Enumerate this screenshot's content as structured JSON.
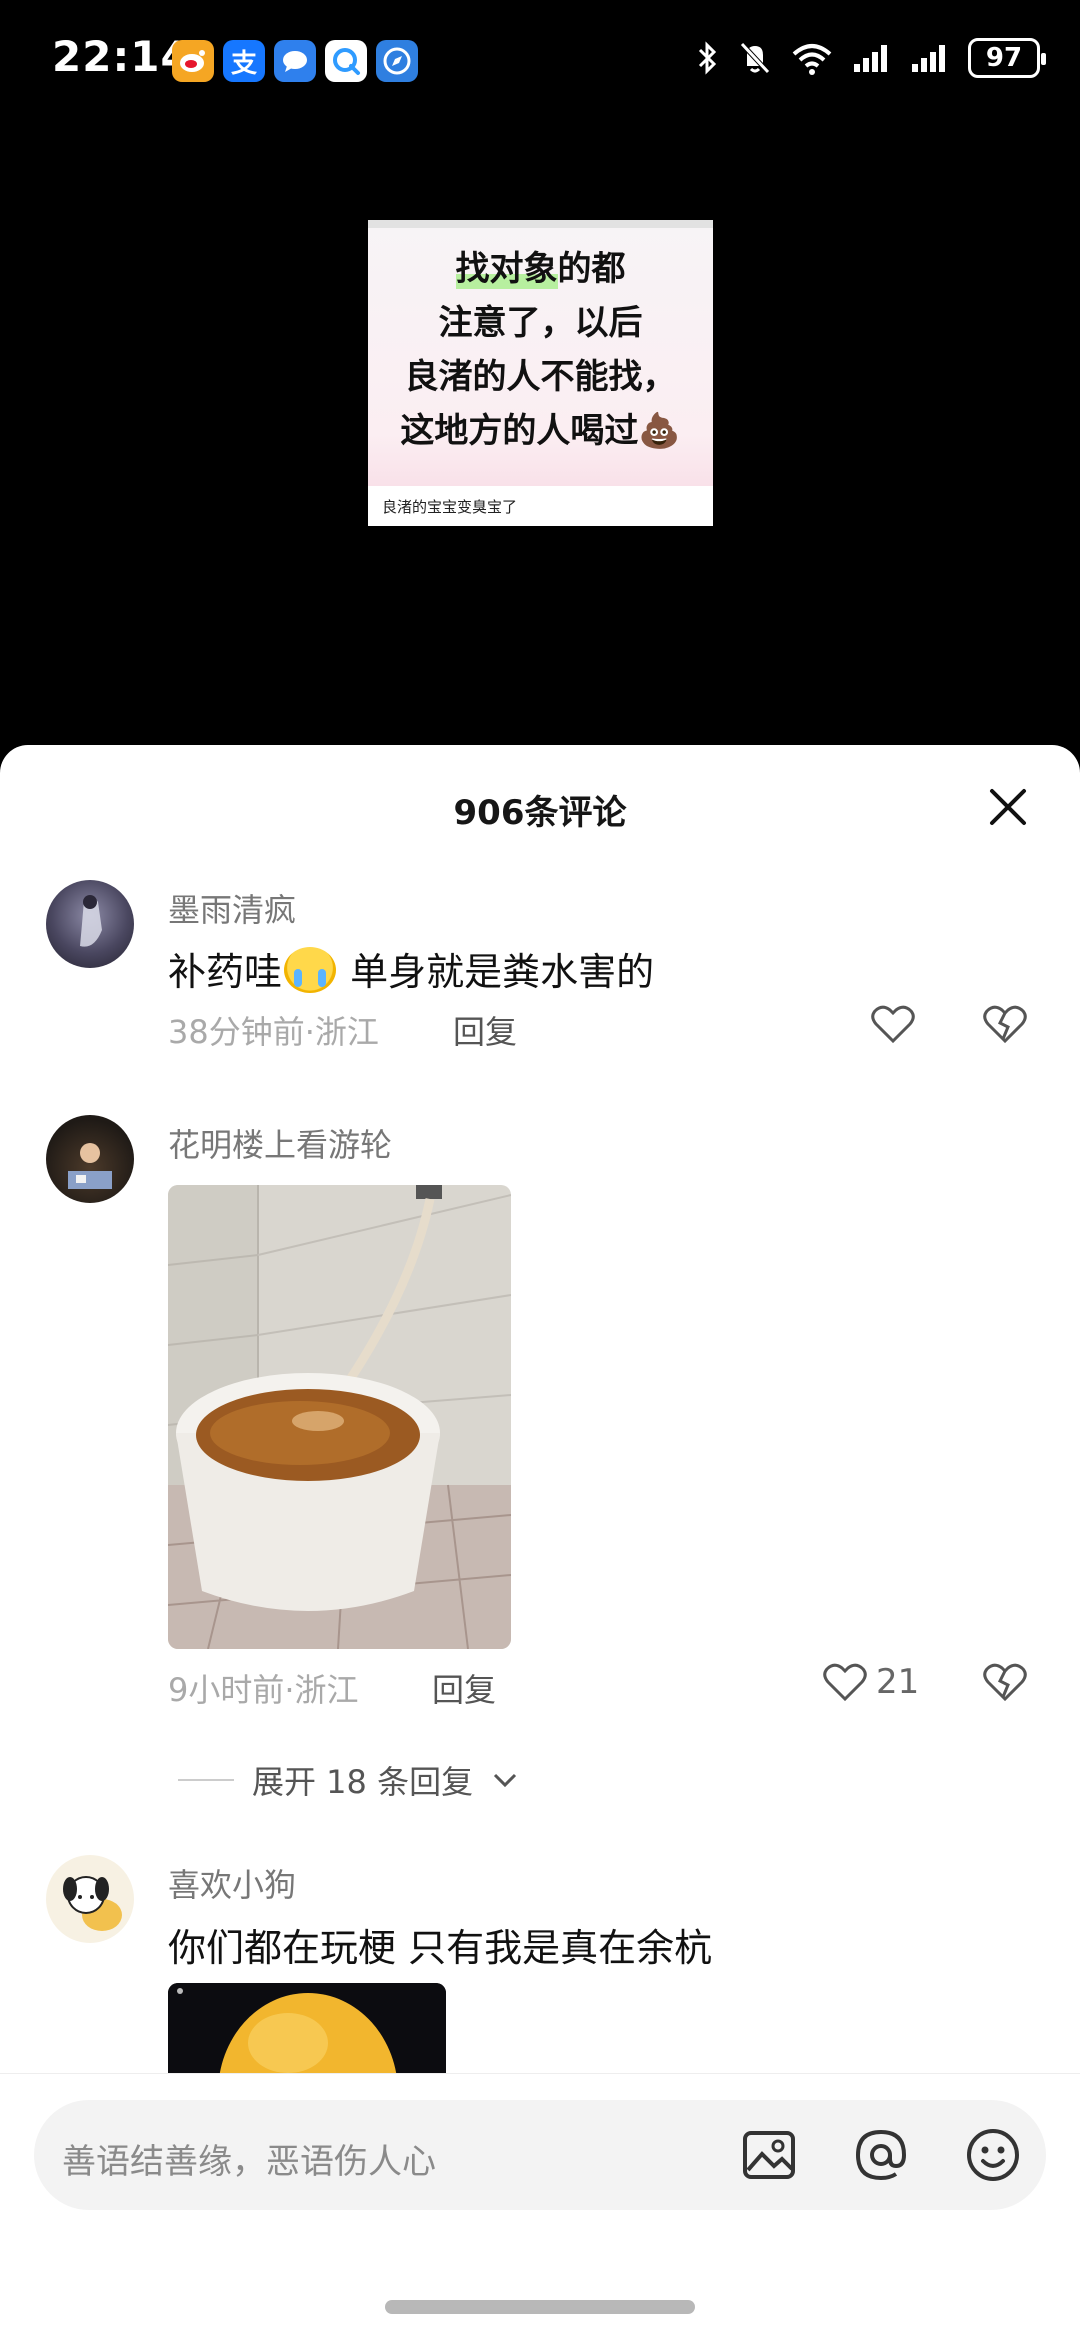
{
  "status_bar": {
    "time": "22:14",
    "battery": "97",
    "app_icons": [
      {
        "name": "weibo-icon",
        "color": "#f5a623",
        "glyph": "◉"
      },
      {
        "name": "alipay-icon",
        "color": "#1677ff",
        "glyph": "支"
      },
      {
        "name": "message-icon",
        "color": "#2f80ed",
        "glyph": "●"
      },
      {
        "name": "qq-browser-icon",
        "color": "#3aa0ff",
        "glyph": "Q"
      },
      {
        "name": "compass-icon",
        "color": "#2f7fe0",
        "glyph": "◈"
      }
    ]
  },
  "preview": {
    "highlight_line": "找对象",
    "line1_rest": "的都",
    "lines_rest": "注意了，以后\n良渚的人不能找，\n这地方的人喝过💩",
    "caption": "良渚的宝宝变臭宝了"
  },
  "sheet": {
    "title": "906条评论"
  },
  "comments": [
    {
      "name": "墨雨清疯",
      "text_before": "补药哇",
      "text_after": " 单身就是粪水害的",
      "meta": "38分钟前·浙江",
      "reply": "回复",
      "likes": ""
    },
    {
      "name": "花明楼上看游轮",
      "meta": "9小时前·浙江",
      "reply": "回复",
      "likes": "21",
      "expand": "展开 18 条回复"
    },
    {
      "name": "喜欢小狗",
      "text": "你们都在玩梗 只有我是真在余杭"
    }
  ],
  "input": {
    "placeholder": "善语结善缘，恶语伤人心"
  }
}
